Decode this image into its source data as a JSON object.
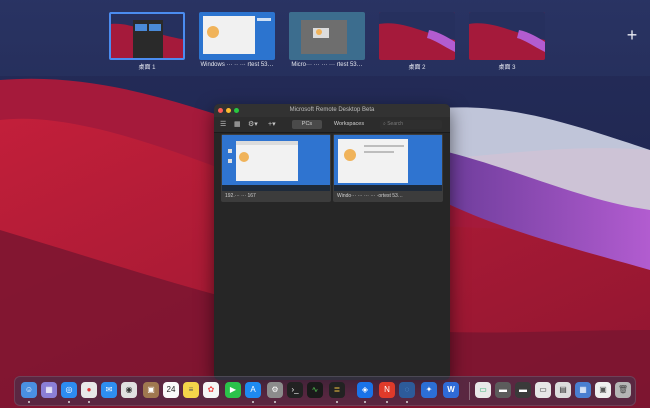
{
  "spaces": [
    {
      "label": "桌面 1",
      "active": true
    },
    {
      "label": "Windows ··· ·· ··· rtest 53…",
      "active": false
    },
    {
      "label": "Micro··· ··· ··· ··· rtest 53…",
      "active": false
    },
    {
      "label": "桌面 2",
      "active": false
    },
    {
      "label": "桌面 3",
      "active": false
    }
  ],
  "add_space": "+",
  "window": {
    "title": "Microsoft Remote Desktop Beta",
    "tab_pcs": "PCs",
    "tab_workspaces": "Workspaces",
    "search_placeholder": "Search",
    "pcs": [
      {
        "label": "192.··· ··· 167"
      },
      {
        "label": "Windo··· ··· ··· ··· ·ortest 53…"
      }
    ]
  },
  "dock": {
    "calendar_day": "24",
    "apps": [
      "finder",
      "launchpad",
      "safari",
      "chrome",
      "mail",
      "screenshot",
      "contacts",
      "calendar",
      "notes",
      "photos",
      "facetime",
      "app-store",
      "system-preferences",
      "terminal",
      "activity-monitor",
      "textedit-terminal",
      "remote-desktop",
      "office",
      "edge-canary",
      "xcode-tool",
      "wps",
      "preview",
      "window-1",
      "window-2",
      "window-3",
      "window-4",
      "window-5",
      "trash"
    ],
    "colors": {
      "accent": "#4b8cf0"
    }
  }
}
